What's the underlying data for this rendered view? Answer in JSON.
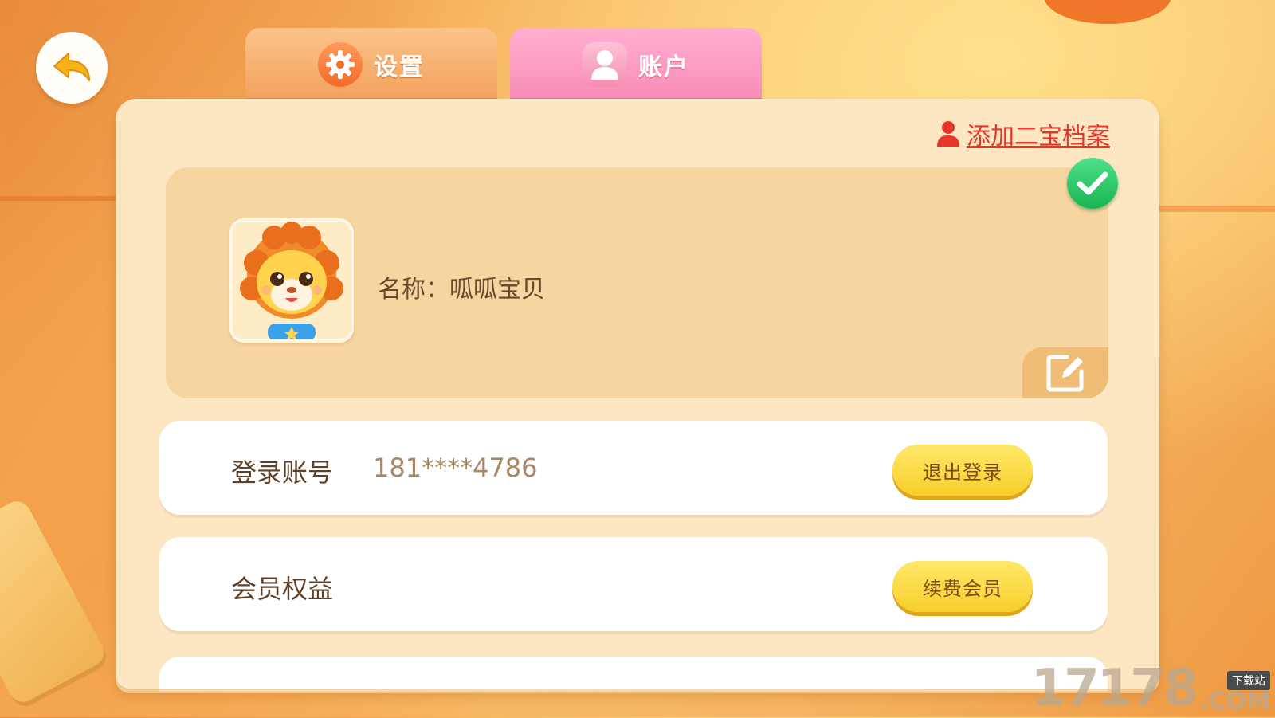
{
  "tabs": [
    {
      "label": "设置",
      "icon": "gear-icon",
      "active": false
    },
    {
      "label": "账户",
      "icon": "user-icon",
      "active": true
    }
  ],
  "header": {
    "add_profile_label": "添加二宝档案"
  },
  "profile": {
    "name_line": "名称：呱呱宝贝",
    "selected": true
  },
  "account": {
    "login_label": "登录账号",
    "login_value": "181****4786",
    "logout_button": "退出登录",
    "member_label": "会员权益",
    "renew_button": "续费会员"
  },
  "watermark": {
    "number": "17178",
    "tag": "下载站",
    "suffix": ".COM"
  },
  "colors": {
    "accent_red": "#e8352a",
    "button_yellow": "#f7cf2b",
    "check_green": "#19b451",
    "tab_pink": "#f98bb7",
    "tab_orange": "#f2a05b"
  }
}
